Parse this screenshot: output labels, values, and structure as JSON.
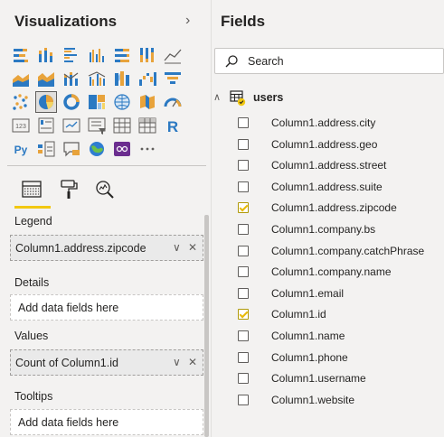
{
  "visualizations": {
    "title": "Visualizations",
    "collapse_glyph": "›",
    "icons": [
      {
        "name": "stacked-bar-chart-icon"
      },
      {
        "name": "stacked-column-chart-icon"
      },
      {
        "name": "clustered-bar-chart-icon"
      },
      {
        "name": "clustered-column-chart-icon"
      },
      {
        "name": "100-stacked-bar-chart-icon"
      },
      {
        "name": "100-stacked-column-chart-icon"
      },
      {
        "name": "line-chart-icon"
      },
      {
        "name": "area-chart-icon"
      },
      {
        "name": "stacked-area-chart-icon"
      },
      {
        "name": "line-and-stacked-column-icon"
      },
      {
        "name": "line-and-clustered-column-icon"
      },
      {
        "name": "ribbon-chart-icon"
      },
      {
        "name": "waterfall-chart-icon"
      },
      {
        "name": "funnel-icon"
      },
      {
        "name": "scatter-chart-icon"
      },
      {
        "name": "pie-chart-icon",
        "selected": true
      },
      {
        "name": "donut-chart-icon"
      },
      {
        "name": "treemap-icon"
      },
      {
        "name": "map-icon"
      },
      {
        "name": "filled-map-icon"
      },
      {
        "name": "gauge-icon"
      },
      {
        "name": "card-icon"
      },
      {
        "name": "multi-row-card-icon"
      },
      {
        "name": "kpi-icon"
      },
      {
        "name": "slicer-icon"
      },
      {
        "name": "table-icon"
      },
      {
        "name": "matrix-icon"
      },
      {
        "name": "r-script-visual-icon"
      },
      {
        "name": "python-visual-icon"
      },
      {
        "name": "key-influencers-icon"
      },
      {
        "name": "qa-icon"
      },
      {
        "name": "arcgis-map-icon"
      },
      {
        "name": "custom-visual-icon"
      },
      {
        "name": "more-visuals-icon"
      }
    ],
    "tabs": [
      {
        "name": "fields-tab-icon"
      },
      {
        "name": "format-tab-icon"
      },
      {
        "name": "analytics-tab-icon"
      }
    ],
    "wells": {
      "legend": {
        "label": "Legend",
        "value": "Column1.address.zipcode"
      },
      "details": {
        "label": "Details",
        "placeholder": "Add data fields here"
      },
      "values": {
        "label": "Values",
        "value": "Count of Column1.id"
      },
      "tooltips": {
        "label": "Tooltips",
        "placeholder": "Add data fields here"
      }
    },
    "well_controls": {
      "expand_glyph": "∨",
      "remove_glyph": "✕"
    }
  },
  "fields": {
    "title": "Fields",
    "search": {
      "placeholder": "Search"
    },
    "table": {
      "name": "users",
      "expanded_glyph": "∧",
      "items": [
        {
          "label": "Column1.address.city",
          "checked": false
        },
        {
          "label": "Column1.address.geo",
          "checked": false
        },
        {
          "label": "Column1.address.street",
          "checked": false
        },
        {
          "label": "Column1.address.suite",
          "checked": false
        },
        {
          "label": "Column1.address.zipcode",
          "checked": true
        },
        {
          "label": "Column1.company.bs",
          "checked": false
        },
        {
          "label": "Column1.company.catchPhrase",
          "checked": false
        },
        {
          "label": "Column1.company.name",
          "checked": false
        },
        {
          "label": "Column1.email",
          "checked": false
        },
        {
          "label": "Column1.id",
          "checked": true
        },
        {
          "label": "Column1.name",
          "checked": false
        },
        {
          "label": "Column1.phone",
          "checked": false
        },
        {
          "label": "Column1.username",
          "checked": false
        },
        {
          "label": "Column1.website",
          "checked": false
        }
      ]
    }
  },
  "colors": {
    "accent_yellow": "#f2c811",
    "pane_bg": "#f3f2f1",
    "text": "#252423"
  }
}
